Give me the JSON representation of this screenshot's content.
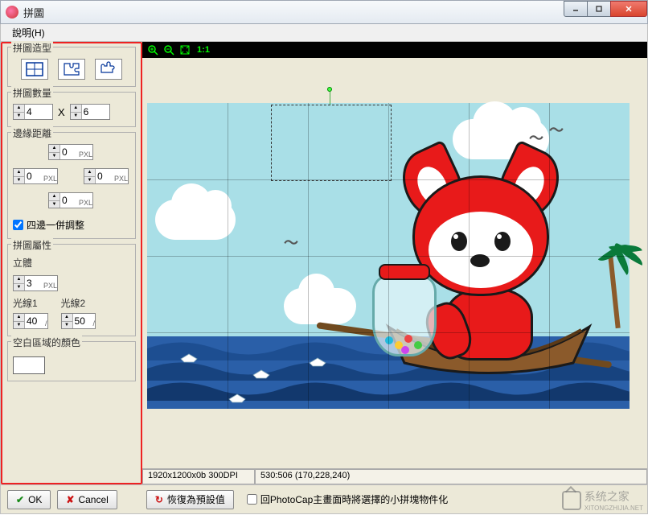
{
  "window": {
    "title": "拼圖"
  },
  "menu": {
    "help": "說明(H)"
  },
  "panel": {
    "shape": {
      "title": "拼圖造型"
    },
    "count": {
      "title": "拼圖數量",
      "cols": "4",
      "rows": "6",
      "x_label": "X"
    },
    "edge": {
      "title": "邊緣距離",
      "top": "0",
      "left": "0",
      "right": "0",
      "bottom": "0",
      "unit": "PXL",
      "sync_label": "四邊一併調整",
      "sync_checked": true
    },
    "attr": {
      "title": "拼圖屬性",
      "depth_label": "立體",
      "depth": "3",
      "unit": "PXL",
      "light1_label": "光線1",
      "light1": "40",
      "light2_label": "光線2",
      "light2": "50",
      "slash": "/"
    },
    "blank": {
      "title": "空白區域的顏色"
    }
  },
  "toolbar": {
    "fit_label": "1:1"
  },
  "status": {
    "dims": "1920x1200x0b  300DPI",
    "pos": "530:506 (170,228,240)"
  },
  "buttons": {
    "ok": "OK",
    "cancel": "Cancel",
    "reset": "恢復為預設值",
    "export_chk": "回PhotoCap主畫面時將選擇的小拼塊物件化"
  },
  "watermark": {
    "text": "系统之家",
    "sub": "XITONGZHIJIA.NET"
  }
}
